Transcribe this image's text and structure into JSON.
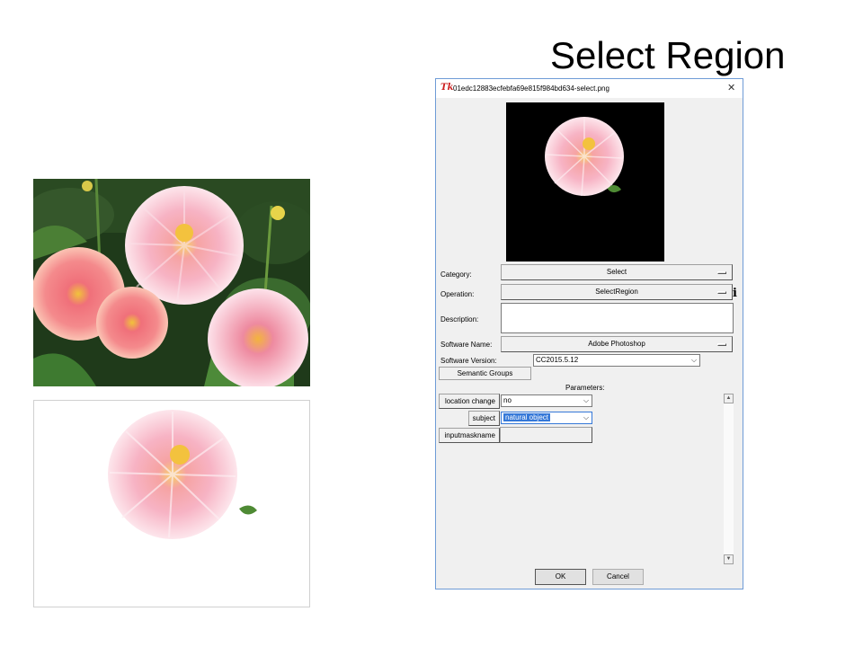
{
  "slide": {
    "title": "Select Region"
  },
  "images": {
    "photo": "flower-photo",
    "mask": "flower-mask-result"
  },
  "dialog": {
    "title": "01edc12883ecfebfa69e815f984bd634-select.png",
    "icon_text": "Tk",
    "close_symbol": "✕",
    "info_symbol": "i",
    "category": {
      "label": "Category:",
      "value": "Select"
    },
    "operation": {
      "label": "Operation:",
      "value": "SelectRegion"
    },
    "description": {
      "label": "Description:",
      "value": ""
    },
    "software_name": {
      "label": "Software Name:",
      "value": "Adobe Photoshop"
    },
    "software_version": {
      "label": "Software Version:",
      "value": "CC2015.5.12"
    },
    "semantic_groups_label": "Semantic Groups",
    "parameters_label": "Parameters:",
    "parameters": [
      {
        "name": "location change",
        "value": "no"
      },
      {
        "name": "subject",
        "value": "natural object"
      },
      {
        "name": "inputmaskname",
        "value": ""
      }
    ],
    "ok_label": "OK",
    "cancel_label": "Cancel",
    "scroll_up_symbol": "▲",
    "scroll_down_symbol": "▼",
    "dropdown_arrow": "⌵"
  },
  "colors": {
    "accent": "#3578d8",
    "dialog_border": "#6e9bd6",
    "tk_icon": "#cc1f1f"
  }
}
